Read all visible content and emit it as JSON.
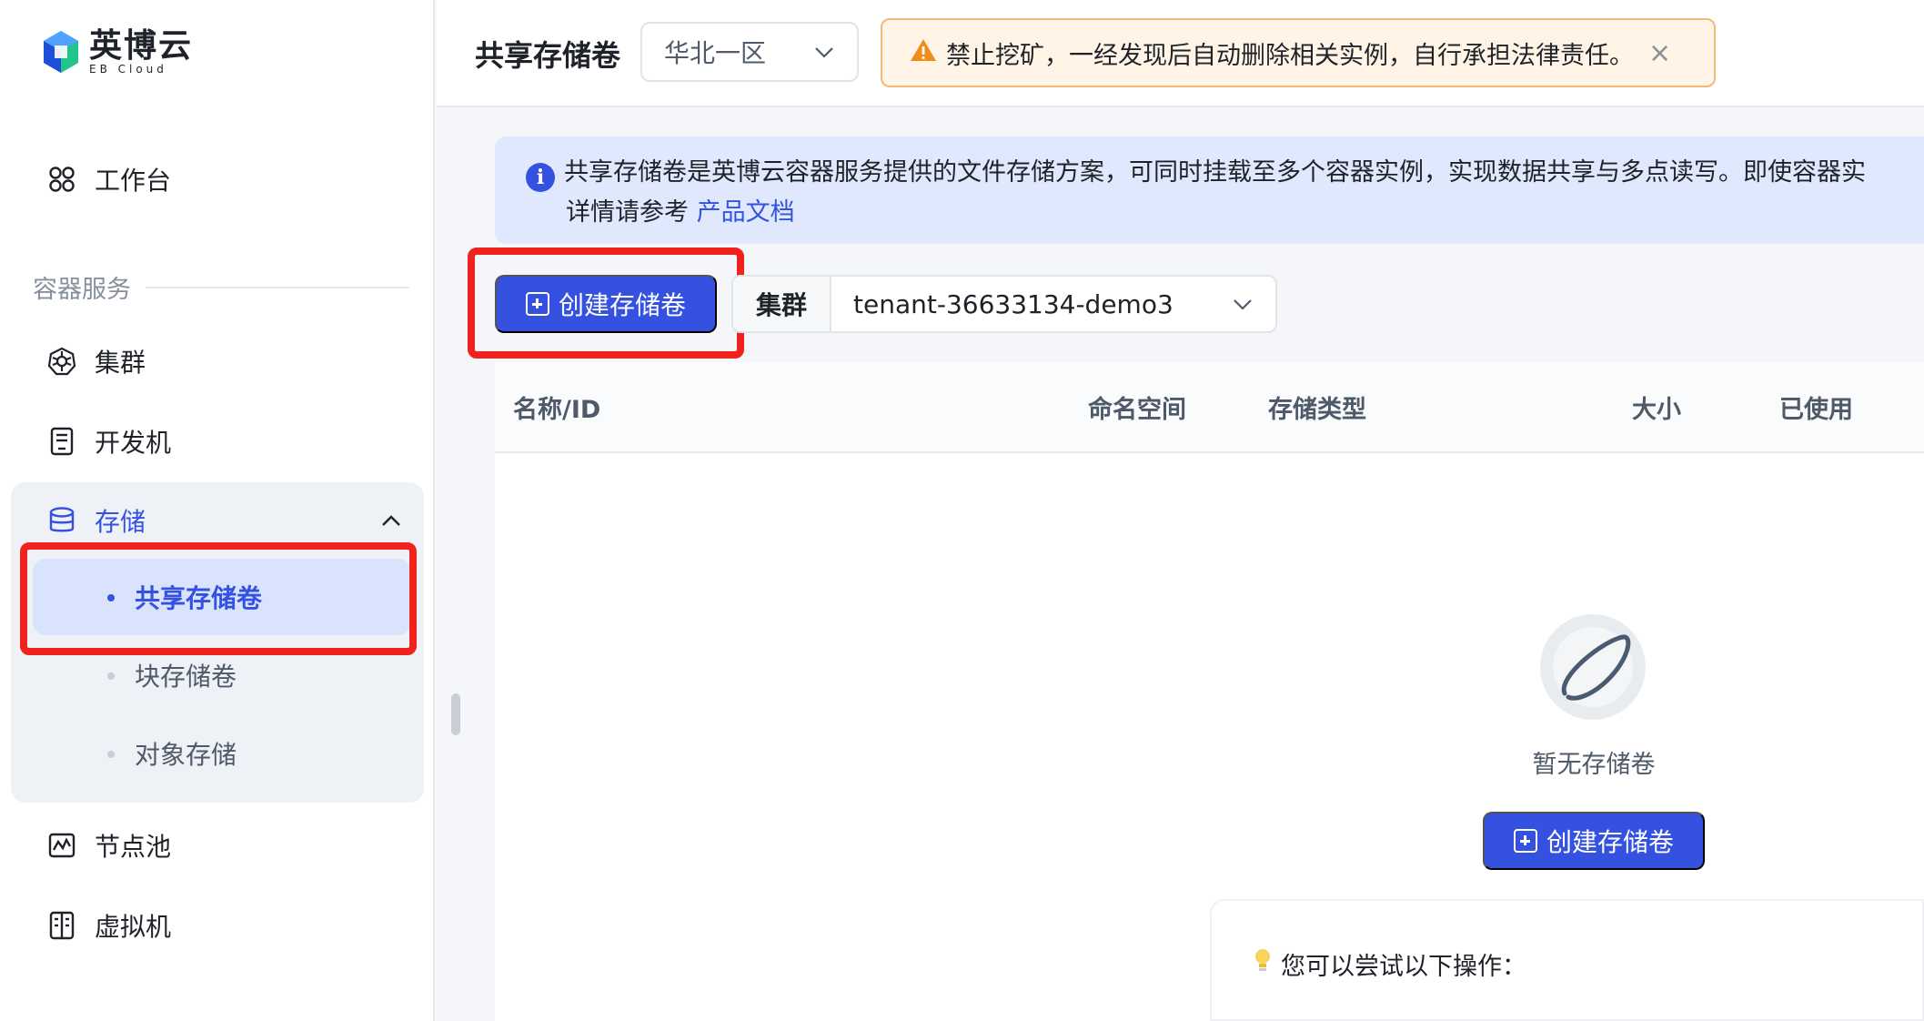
{
  "brand": {
    "name": "英博云",
    "sub": "EB Cloud"
  },
  "sidebar": {
    "workbench": "工作台",
    "section": "容器服务",
    "items": {
      "cluster": "集群",
      "devmachine": "开发机",
      "nodepool": "节点池",
      "vm": "虚拟机"
    },
    "storage": {
      "label": "存储",
      "children": [
        "共享存储卷",
        "块存储卷",
        "对象存储"
      ]
    }
  },
  "topbar": {
    "title": "共享存储卷",
    "region": "华北一区",
    "warning": "禁止挖矿，一经发现后自动删除相关实例，自行承担法律责任。"
  },
  "info": {
    "line1": "共享存储卷是英博云容器服务提供的文件存储方案，可同时挂载至多个容器实例，实现数据共享与多点读写。即使容器实",
    "line2_prefix": "详情请参考 ",
    "line2_link": "产品文档"
  },
  "toolbar": {
    "create_label": "创建存储卷",
    "cluster_label": "集群",
    "cluster_value": "tenant-36633134-demo3"
  },
  "table": {
    "columns": [
      "名称/ID",
      "命名空间",
      "存储类型",
      "大小",
      "已使用"
    ]
  },
  "empty": {
    "text": "暂无存储卷",
    "create_label": "创建存储卷"
  },
  "tips": {
    "text": "您可以尝试以下操作："
  },
  "colors": {
    "primary": "#3451e0",
    "highlight": "#f0231c",
    "warning_bg": "#fff4e5",
    "info_bg": "#dfe8fd"
  }
}
